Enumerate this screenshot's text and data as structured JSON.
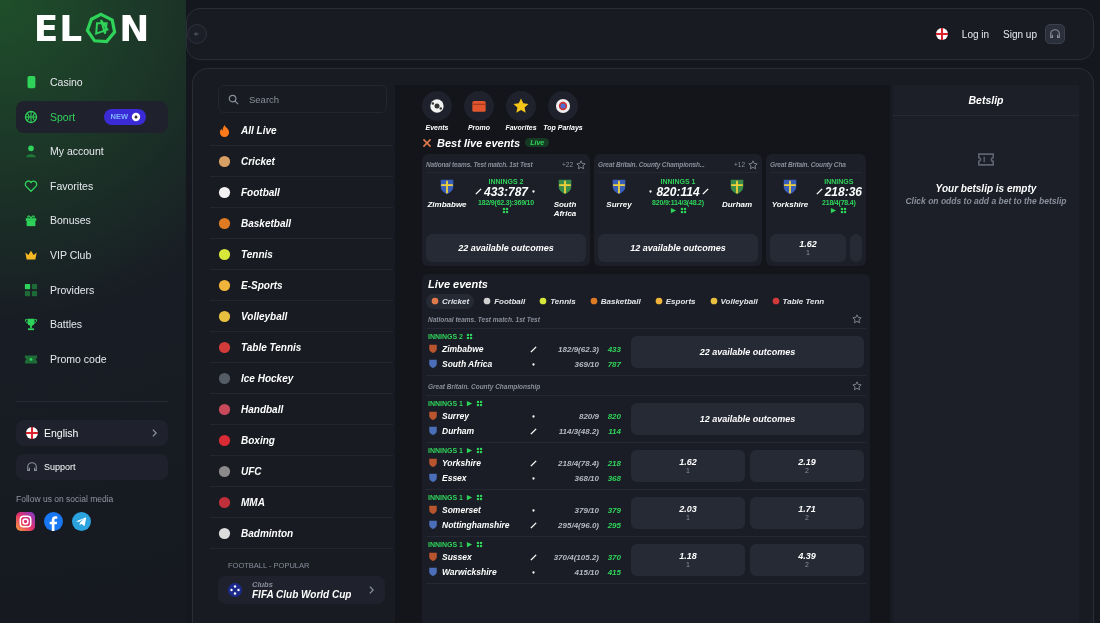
{
  "logo": {
    "before": "EL",
    "after": "N"
  },
  "nav": [
    {
      "label": "Casino",
      "selected": false
    },
    {
      "label": "Sport",
      "selected": true,
      "badge": "NEW"
    },
    {
      "label": "My account",
      "selected": false
    },
    {
      "label": "Favorites",
      "selected": false
    },
    {
      "label": "Bonuses",
      "selected": false
    },
    {
      "label": "VIP Club",
      "selected": false
    },
    {
      "label": "Providers",
      "selected": false
    },
    {
      "label": "Battles",
      "selected": false
    },
    {
      "label": "Promo code",
      "selected": false
    }
  ],
  "language": "English",
  "support": "Support",
  "social_heading": "Follow us on social media",
  "topbar": {
    "login": "Log in",
    "signup": "Sign up"
  },
  "search": {
    "placeholder": "Search"
  },
  "sports": [
    "All Live",
    "Cricket",
    "Football",
    "Basketball",
    "Tennis",
    "E-Sports",
    "Volleyball",
    "Table Tennis",
    "Ice Hockey",
    "Handball",
    "Boxing",
    "UFC",
    "MMA",
    "Badminton"
  ],
  "popular": {
    "heading": "FOOTBALL - POPULAR",
    "category": "Clubs",
    "title": "FIFA Club World Cup"
  },
  "quick_links": [
    "Events",
    "Promo",
    "Favorites",
    "Top Parlays"
  ],
  "best_live": {
    "title": "Best live events",
    "badge": "Live",
    "cards": [
      {
        "league": "National teams. Test match. 1st Test",
        "more": "+22",
        "teams": [
          {
            "name": "Zimbabwe",
            "batting": true
          },
          {
            "name": "South Africa",
            "batting": false
          }
        ],
        "period": "INNINGS 2",
        "score": "433:787",
        "detail": "182/9(62.3):369/10",
        "play": false,
        "outcomes": "22 available outcomes"
      },
      {
        "league": "Great Britain. County Championsh...",
        "more": "+12",
        "teams": [
          {
            "name": "Surrey",
            "batting": false
          },
          {
            "name": "Durham",
            "batting": true
          }
        ],
        "period": "INNINGS 1",
        "score": "820:114",
        "detail": "820/9:114/3(48.2)",
        "play": true,
        "outcomes": "12 available outcomes"
      },
      {
        "league": "Great Britain. County Cha",
        "teams": [
          {
            "name": "Yorkshire",
            "batting": true
          }
        ],
        "period": "INNINGS",
        "score": "218:36",
        "detail": "218/4(78.4)",
        "play": true,
        "odds": [
          {
            "price": "1.62",
            "label": "1"
          }
        ]
      }
    ]
  },
  "live": {
    "title": "Live events",
    "tabs": [
      {
        "label": "Cricket",
        "selected": true
      },
      {
        "label": "Football",
        "selected": false
      },
      {
        "label": "Tennis",
        "selected": false
      },
      {
        "label": "Basketball",
        "selected": false
      },
      {
        "label": "Esports",
        "selected": false
      },
      {
        "label": "Volleyball",
        "selected": false
      },
      {
        "label": "Table Tenn",
        "selected": false
      }
    ],
    "groups": [
      {
        "league": "National teams. Test match. 1st Test",
        "matches": [
          {
            "period": "INNINGS 2",
            "play": false,
            "teams": [
              {
                "name": "Zimbabwe",
                "batting": true,
                "detail": "182/9(62.3)",
                "total": "433"
              },
              {
                "name": "South Africa",
                "batting": false,
                "detail": "369/10",
                "total": "787"
              }
            ],
            "outcomes": "22 available outcomes"
          }
        ]
      },
      {
        "league": "Great Britain. County Championship",
        "matches": [
          {
            "period": "INNINGS 1",
            "play": true,
            "teams": [
              {
                "name": "Surrey",
                "batting": false,
                "detail": "820/9",
                "total": "820"
              },
              {
                "name": "Durham",
                "batting": true,
                "detail": "114/3(48.2)",
                "total": "114"
              }
            ],
            "outcomes": "12 available outcomes"
          },
          {
            "period": "INNINGS 1",
            "play": true,
            "teams": [
              {
                "name": "Yorkshire",
                "batting": true,
                "detail": "218/4(78.4)",
                "total": "218"
              },
              {
                "name": "Essex",
                "batting": false,
                "detail": "368/10",
                "total": "368"
              }
            ],
            "odds": [
              {
                "price": "1.62",
                "label": "1"
              },
              {
                "price": "2.19",
                "label": "2"
              }
            ]
          },
          {
            "period": "INNINGS 1",
            "play": true,
            "teams": [
              {
                "name": "Somerset",
                "batting": false,
                "detail": "379/10",
                "total": "379"
              },
              {
                "name": "Nottinghamshire",
                "batting": true,
                "detail": "295/4(96.0)",
                "total": "295"
              }
            ],
            "odds": [
              {
                "price": "2.03",
                "label": "1"
              },
              {
                "price": "1.71",
                "label": "2"
              }
            ]
          },
          {
            "period": "INNINGS 1",
            "play": true,
            "teams": [
              {
                "name": "Sussex",
                "batting": true,
                "detail": "370/4(105.2)",
                "total": "370"
              },
              {
                "name": "Warwickshire",
                "batting": false,
                "detail": "415/10",
                "total": "415"
              }
            ],
            "odds": [
              {
                "price": "1.18",
                "label": "1"
              },
              {
                "price": "4.39",
                "label": "2"
              }
            ]
          }
        ]
      }
    ]
  },
  "betslip": {
    "title": "Betslip",
    "empty_title": "Your betslip is empty",
    "empty_hint": "Click on odds to add a bet to the betslip"
  }
}
